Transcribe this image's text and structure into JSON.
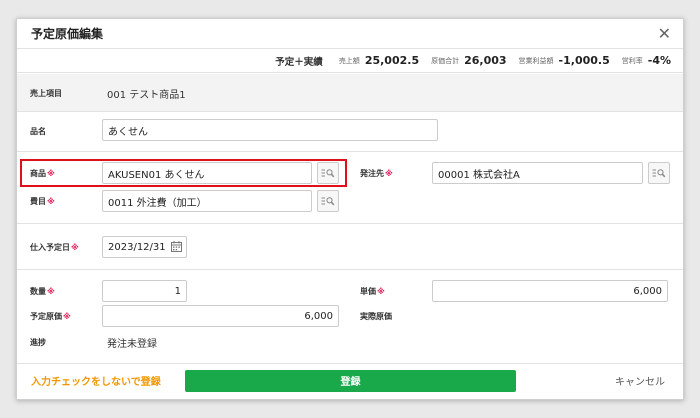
{
  "dialog": {
    "title": "予定原価編集",
    "close_glyph": "✕"
  },
  "summary": {
    "mode": "予定＋実績",
    "items": [
      {
        "label": "売上額",
        "value": "25,002.5"
      },
      {
        "label": "原価合計",
        "value": "26,003"
      },
      {
        "label": "営業利益額",
        "value": "-1,000.5"
      },
      {
        "label": "営利率",
        "value": "-4%"
      }
    ]
  },
  "sales_item": {
    "label": "売上項目",
    "value": "001 テスト商品1"
  },
  "item_name": {
    "label": "品名",
    "value": "あくせん"
  },
  "product": {
    "label": "商品",
    "required_mark": "※",
    "value": "AKUSEN01 あくせん"
  },
  "supplier": {
    "label": "発注先",
    "required_mark": "※",
    "value": "00001 株式会社A"
  },
  "expense": {
    "label": "費目",
    "required_mark": "※",
    "value": "0011 外注費（加工）"
  },
  "purchase_date": {
    "label": "仕入予定日",
    "required_mark": "※",
    "value": "2023/12/31"
  },
  "quantity": {
    "label": "数量",
    "required_mark": "※",
    "value": "1"
  },
  "unit_price": {
    "label": "単価",
    "required_mark": "※",
    "value": "6,000"
  },
  "planned_cost": {
    "label": "予定原価",
    "required_mark": "※",
    "value": "6,000"
  },
  "actual_cost": {
    "label": "実際原価"
  },
  "progress": {
    "label": "進捗",
    "value": "発注未登録"
  },
  "footer": {
    "skip_label": "入力チェックをしないで登録",
    "register_label": "登録",
    "cancel_label": "キャンセル"
  },
  "colors": {
    "accent_green": "#19a94a",
    "warning_orange": "#f29600",
    "required_red": "#e0245e",
    "highlight_red": "#e0101a"
  }
}
